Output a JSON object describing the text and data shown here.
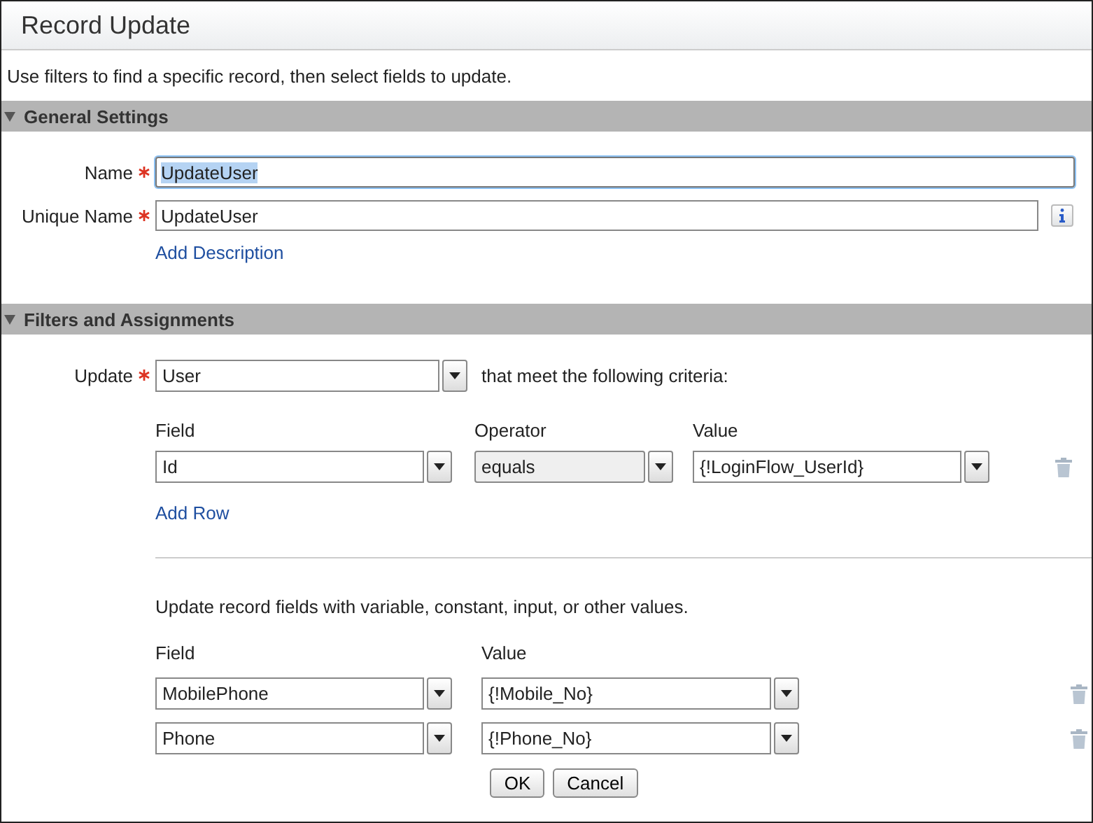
{
  "window": {
    "title": "Record Update"
  },
  "intro": "Use filters to find a specific record, then select fields to update.",
  "general": {
    "title": "General Settings",
    "expanded": true,
    "fields": [
      {
        "label": "Name",
        "required": true,
        "value": "UpdateUser",
        "focused": true,
        "text_selected": true,
        "info": false
      },
      {
        "label": "Unique Name",
        "required": true,
        "value": "UpdateUser",
        "focused": false,
        "text_selected": false,
        "info": true
      }
    ],
    "link": "Add Description"
  },
  "filters": {
    "title": "Filters and Assignments",
    "expanded": true,
    "object": {
      "label": "Update",
      "required": true,
      "value": "User"
    },
    "criteria_text": "that meet the following criteria:",
    "columns": [
      "Field",
      "Operator",
      "Value"
    ],
    "rows": [
      {
        "field": "Id",
        "operator": "equals",
        "value": "{!LoginFlow_UserId}"
      }
    ],
    "add_row": "Add Row",
    "assign_text": "Update record fields with variable, constant, input, or other values.",
    "assign_columns": [
      "Field",
      "Value"
    ],
    "assignments": [
      {
        "field": "MobilePhone",
        "value": "{!Mobile_No}"
      },
      {
        "field": "Phone",
        "value": "{!Phone_No}"
      }
    ]
  },
  "buttons": [
    "OK",
    "Cancel"
  ]
}
